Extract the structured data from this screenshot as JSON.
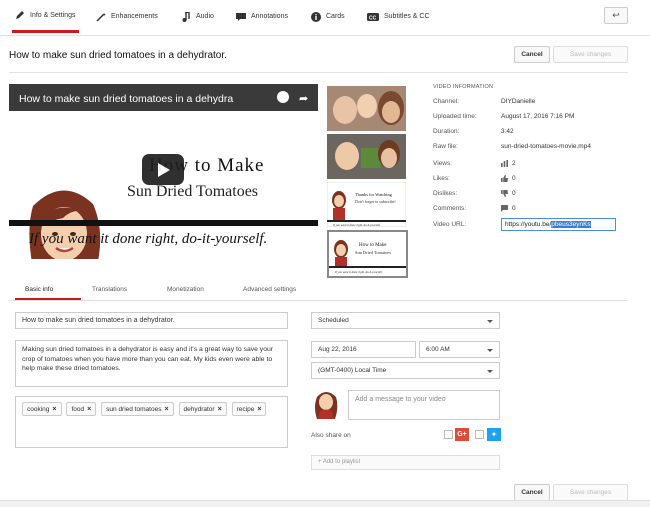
{
  "tabs": [
    {
      "label": "Info & Settings",
      "icon": "pencil-icon",
      "active": true
    },
    {
      "label": "Enhancements",
      "icon": "magic-wand-icon",
      "active": false
    },
    {
      "label": "Audio",
      "icon": "music-note-icon",
      "active": false
    },
    {
      "label": "Annotations",
      "icon": "speech-bubble-icon",
      "active": false
    },
    {
      "label": "Cards",
      "icon": "info-circle-icon",
      "active": false
    },
    {
      "label": "Subtitles & CC",
      "icon": "cc-icon",
      "active": false
    }
  ],
  "header": {
    "video_title": "How to make sun dried tomatoes in a dehydrator.",
    "cancel_label": "Cancel",
    "save_label": "Save changes"
  },
  "player": {
    "title": "How to make sun dried tomatoes in a dehydra",
    "thumb_line1": "How to Make",
    "thumb_line2": "Sun Dried Tomatoes",
    "slogan": "If you want it done right, do-it-yourself."
  },
  "thumbnails": [
    {
      "kind": "photo"
    },
    {
      "kind": "photo"
    },
    {
      "kind": "card",
      "line1": "Thanks for Watching",
      "line2": "Don't forget to subscribe!"
    },
    {
      "kind": "card",
      "line1": "How to Make",
      "line2": "Sun Dried Tomatoes",
      "selected": true
    }
  ],
  "video_info": {
    "heading": "VIDEO INFORMATION",
    "rows": [
      {
        "label": "Channel:",
        "value": "DIYDanielle"
      },
      {
        "label": "Uploaded time:",
        "value": "August 17, 2016 7:16 PM"
      },
      {
        "label": "Duration:",
        "value": "3:42"
      },
      {
        "label": "Raw file:",
        "value": "sun-dried-tomatoes-movie.mp4"
      },
      {
        "label": "Views:",
        "value": "2",
        "icon": "bar-chart-icon"
      },
      {
        "label": "Likes:",
        "value": "0",
        "icon": "thumbs-up-icon"
      },
      {
        "label": "Dislikes:",
        "value": "0",
        "icon": "thumbs-down-icon"
      },
      {
        "label": "Comments:",
        "value": "0",
        "icon": "comment-icon"
      }
    ],
    "url_label": "Video URL:",
    "url_prefix": "https://youtu.be/",
    "url_selected": "pbeus3eynKs"
  },
  "subtabs": [
    "Basic info",
    "Translations",
    "Monetization",
    "Advanced settings"
  ],
  "form": {
    "title_value": "How to make sun dried  tomatoes in a dehydrator.",
    "description": "Making sun dried tomatoes in a dehydrator is easy and it's a great way to save your crop of tomatoes when you have more than you can eat. My kids even were able to help make these dried tomatoes.",
    "tags": [
      "cooking",
      "food",
      "sun dried tomatoes",
      "dehydrator",
      "recipe"
    ],
    "visibility": "Scheduled",
    "date": "Aug 22, 2016",
    "time": "6:00 AM",
    "timezone": "(GMT-0400) Local Time",
    "message_placeholder": "Add a message to your video",
    "also_share": "Also share on",
    "add_playlist": "+ Add to playlist"
  },
  "footer": {
    "cancel_label": "Cancel",
    "save_label": "Save changes"
  },
  "colors": {
    "accent": "#cc181e",
    "link_blue": "#3b7fd4",
    "gplus": "#dd4b39",
    "twitter": "#1da1f2"
  }
}
